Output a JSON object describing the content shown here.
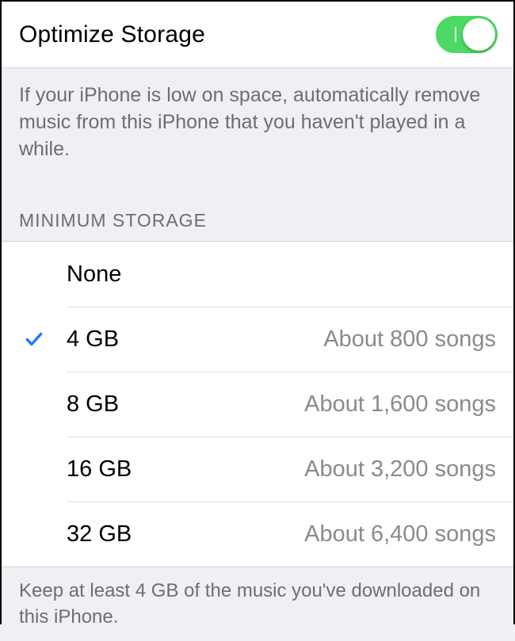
{
  "toggle": {
    "title": "Optimize Storage",
    "on": true
  },
  "description": "If your iPhone is low on space, automatically remove music from this iPhone that you haven't played in a while.",
  "section_header": "MINIMUM STORAGE",
  "options": [
    {
      "label": "None",
      "detail": "",
      "selected": false
    },
    {
      "label": "4 GB",
      "detail": "About 800 songs",
      "selected": true
    },
    {
      "label": "8 GB",
      "detail": "About 1,600 songs",
      "selected": false
    },
    {
      "label": "16 GB",
      "detail": "About 3,200 songs",
      "selected": false
    },
    {
      "label": "32 GB",
      "detail": "About 6,400 songs",
      "selected": false
    }
  ],
  "footer": "Keep at least 4 GB of the music you've downloaded on this iPhone."
}
